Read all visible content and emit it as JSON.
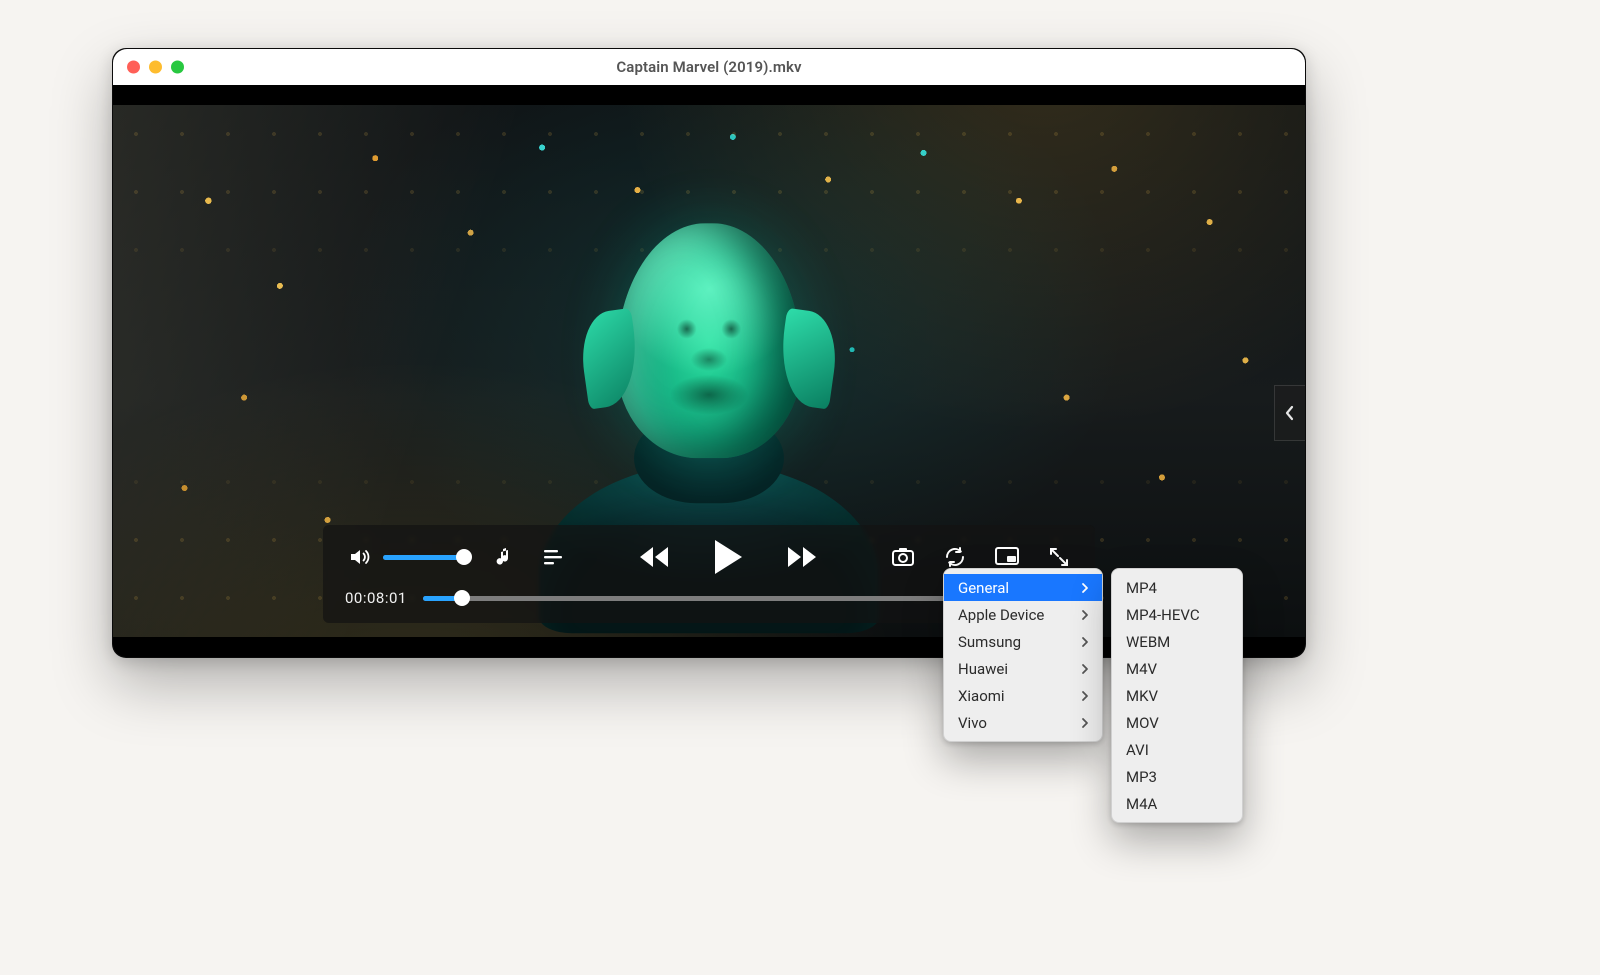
{
  "window": {
    "title": "Captain Marvel (2019).mkv"
  },
  "player": {
    "time_elapsed": "00:08:01",
    "progress_percent": 6,
    "volume_percent": 92
  },
  "convert_menu": {
    "devices": [
      {
        "label": "General",
        "has_submenu": true,
        "selected": true
      },
      {
        "label": "Apple Device",
        "has_submenu": true,
        "selected": false
      },
      {
        "label": "Sumsung",
        "has_submenu": true,
        "selected": false
      },
      {
        "label": "Huawei",
        "has_submenu": true,
        "selected": false
      },
      {
        "label": "Xiaomi",
        "has_submenu": true,
        "selected": false
      },
      {
        "label": "Vivo",
        "has_submenu": true,
        "selected": false
      }
    ],
    "formats": [
      {
        "label": "MP4"
      },
      {
        "label": "MP4-HEVC"
      },
      {
        "label": "WEBM"
      },
      {
        "label": "M4V"
      },
      {
        "label": "MKV"
      },
      {
        "label": "MOV"
      },
      {
        "label": "AVI"
      },
      {
        "label": "MP3"
      },
      {
        "label": "M4A"
      }
    ]
  }
}
